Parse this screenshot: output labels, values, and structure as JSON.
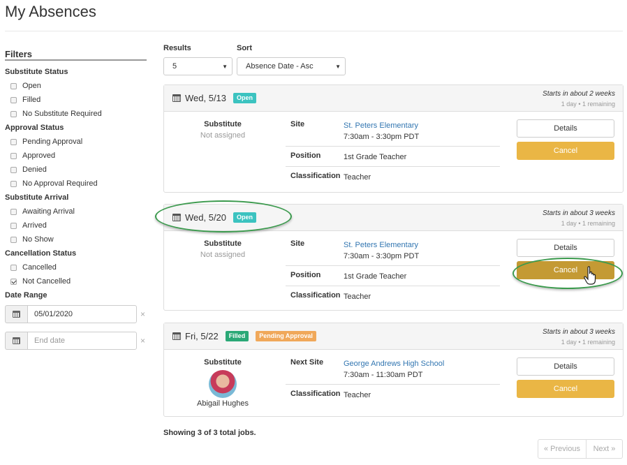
{
  "page": {
    "title": "My Absences"
  },
  "filters": {
    "heading": "Filters",
    "groups": [
      {
        "title": "Substitute Status",
        "options": [
          {
            "label": "Open",
            "checked": false
          },
          {
            "label": "Filled",
            "checked": false
          },
          {
            "label": "No Substitute Required",
            "checked": false
          }
        ]
      },
      {
        "title": "Approval Status",
        "options": [
          {
            "label": "Pending Approval",
            "checked": false
          },
          {
            "label": "Approved",
            "checked": false
          },
          {
            "label": "Denied",
            "checked": false
          },
          {
            "label": "No Approval Required",
            "checked": false
          }
        ]
      },
      {
        "title": "Substitute Arrival",
        "options": [
          {
            "label": "Awaiting Arrival",
            "checked": false
          },
          {
            "label": "Arrived",
            "checked": false
          },
          {
            "label": "No Show",
            "checked": false
          }
        ]
      },
      {
        "title": "Cancellation Status",
        "options": [
          {
            "label": "Cancelled",
            "checked": false
          },
          {
            "label": "Not Cancelled",
            "checked": true
          }
        ]
      }
    ],
    "date_range": {
      "title": "Date Range",
      "start_value": "05/01/2020",
      "end_placeholder": "End date",
      "clear_glyph": "×"
    }
  },
  "controls": {
    "results_label": "Results",
    "results_value": "5",
    "sort_label": "Sort",
    "sort_value": "Absence Date - Asc",
    "caret": "▼"
  },
  "absences": [
    {
      "date": "Wed, 5/13",
      "badges": [
        {
          "text": "Open",
          "kind": "open"
        }
      ],
      "starts": "Starts in about 2 weeks",
      "duration": "1 day",
      "remaining": "1 remaining",
      "substitute_label": "Substitute",
      "substitute_value": "Not assigned",
      "site_label": "Site",
      "site_name": "St. Peters Elementary",
      "time": "7:30am - 3:30pm PDT",
      "position_label": "Position",
      "position": "1st Grade Teacher",
      "classification_label": "Classification",
      "classification": "Teacher",
      "details_label": "Details",
      "cancel_label": "Cancel"
    },
    {
      "date": "Wed, 5/20",
      "badges": [
        {
          "text": "Open",
          "kind": "open"
        }
      ],
      "starts": "Starts in about 3 weeks",
      "duration": "1 day",
      "remaining": "1 remaining",
      "substitute_label": "Substitute",
      "substitute_value": "Not assigned",
      "site_label": "Site",
      "site_name": "St. Peters Elementary",
      "time": "7:30am - 3:30pm PDT",
      "position_label": "Position",
      "position": "1st Grade Teacher",
      "classification_label": "Classification",
      "classification": "Teacher",
      "details_label": "Details",
      "cancel_label": "Cancel"
    },
    {
      "date": "Fri, 5/22",
      "badges": [
        {
          "text": "Filled",
          "kind": "filled"
        },
        {
          "text": "Pending Approval",
          "kind": "pending"
        }
      ],
      "starts": "Starts in about 3 weeks",
      "duration": "1 day",
      "remaining": "1 remaining",
      "substitute_label": "Substitute",
      "substitute_name": "Abigail Hughes",
      "site_label": "Next Site",
      "site_name": "George Andrews High School",
      "time": "7:30am - 11:30am PDT",
      "classification_label": "Classification",
      "classification": "Teacher",
      "details_label": "Details",
      "cancel_label": "Cancel"
    }
  ],
  "footer": {
    "showing": "Showing 3 of 3 total jobs.",
    "prev_label": "« Previous",
    "next_label": "Next »"
  },
  "colors": {
    "accent_cancel": "#eab645",
    "badge_open": "#3cc3c0",
    "badge_filled": "#2aa876",
    "badge_pending": "#f0a85a",
    "highlight": "#3b9a4d"
  }
}
